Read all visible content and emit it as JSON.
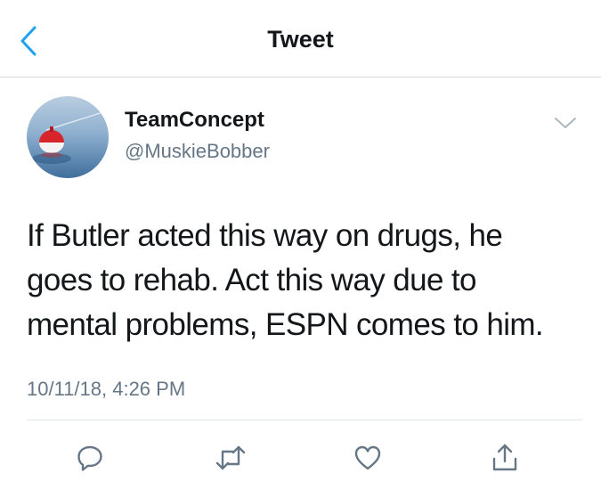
{
  "header": {
    "title": "Tweet",
    "back_icon": "chevron-left-icon"
  },
  "tweet": {
    "author": {
      "display_name": "TeamConcept",
      "handle": "@MuskieBobber",
      "avatar": "fishing-bobber-avatar"
    },
    "text_lines": [
      "If Butler acted this way on drugs, he",
      "goes to rehab. Act this way due to",
      "mental problems, ESPN comes to him."
    ],
    "timestamp": "10/11/18, 4:26 PM",
    "menu_icon": "chevron-down-icon"
  },
  "actions": [
    {
      "name": "reply",
      "icon": "reply-icon"
    },
    {
      "name": "retweet",
      "icon": "retweet-icon"
    },
    {
      "name": "like",
      "icon": "heart-icon"
    },
    {
      "name": "share",
      "icon": "share-icon"
    }
  ],
  "colors": {
    "accent": "#1da1f2",
    "icon_gray": "#657786",
    "text": "#14171a",
    "divider": "#e1e8ed"
  }
}
